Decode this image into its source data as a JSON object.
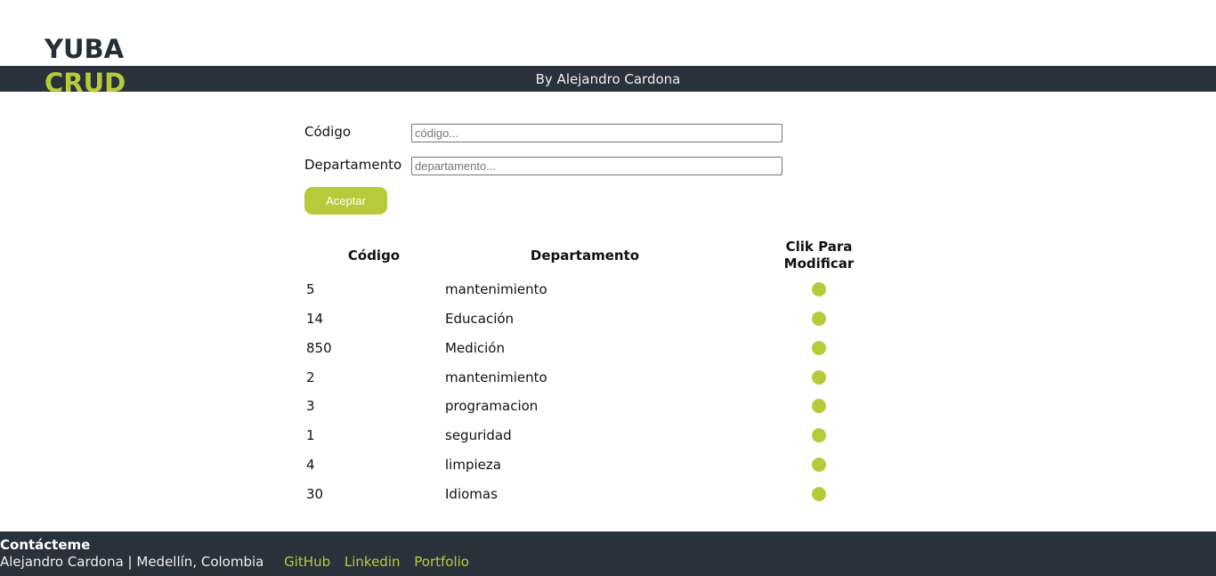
{
  "header": {
    "logo_line1": "YUBA",
    "logo_line2": "CRUD",
    "byline": "By Alejandro Cardona"
  },
  "form": {
    "codigo_label": "Código",
    "codigo_placeholder": "código...",
    "departamento_label": "Departamento",
    "departamento_placeholder": "departamento...",
    "submit_label": "Aceptar"
  },
  "table": {
    "headers": {
      "codigo": "Código",
      "departamento": "Departamento",
      "modificar": "Clik Para Modificar"
    },
    "rows": [
      {
        "codigo": "5",
        "departamento": "mantenimiento"
      },
      {
        "codigo": "14",
        "departamento": "Educación"
      },
      {
        "codigo": "850",
        "departamento": "Medición"
      },
      {
        "codigo": "2",
        "departamento": "mantenimiento"
      },
      {
        "codigo": "3",
        "departamento": "programacion"
      },
      {
        "codigo": "1",
        "departamento": "seguridad"
      },
      {
        "codigo": "4",
        "departamento": "limpieza"
      },
      {
        "codigo": "30",
        "departamento": "Idiomas"
      }
    ]
  },
  "footer": {
    "title": "Contácteme",
    "info": "Alejandro Cardona | Medellín, Colombia",
    "links": [
      "GitHub",
      "Linkedin",
      "Portfolio"
    ]
  },
  "colors": {
    "accent": "#b7cb3a",
    "dark": "#29313b"
  }
}
